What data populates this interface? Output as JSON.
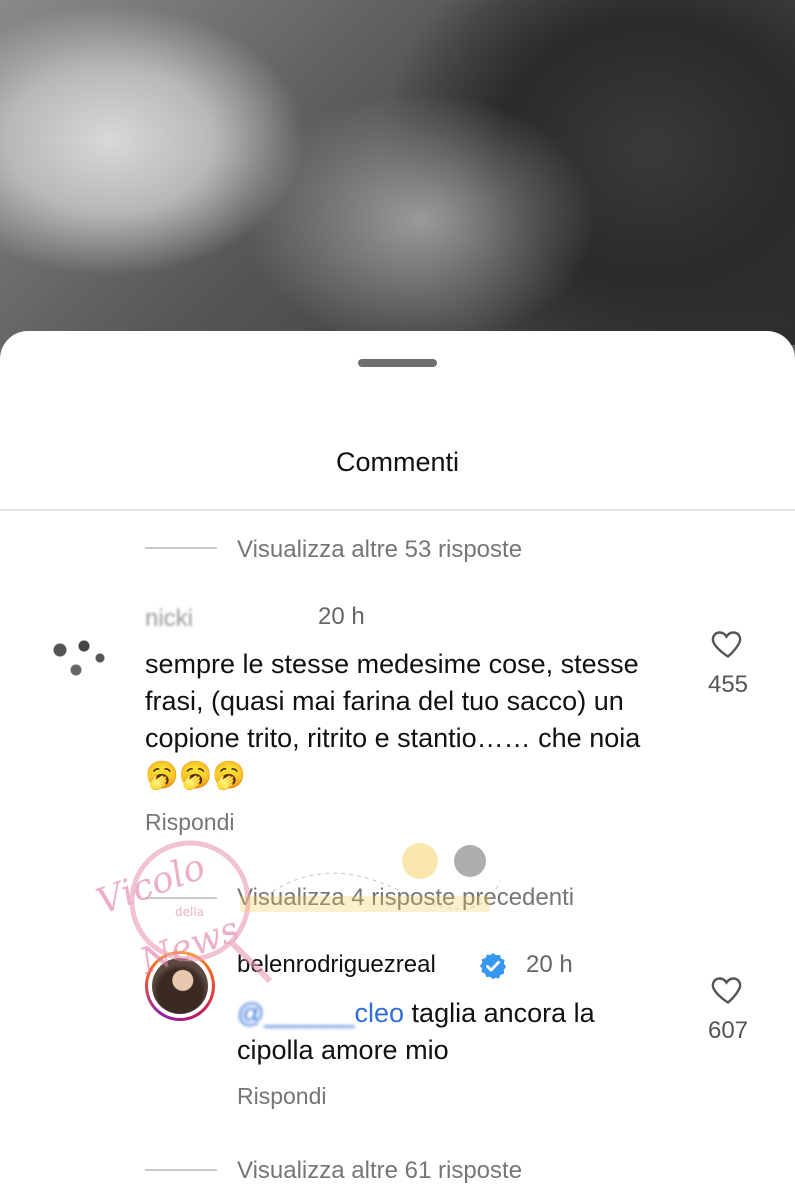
{
  "sheet": {
    "title": "Commenti"
  },
  "thread_top": {
    "view_more": "Visualizza altre 53 risposte"
  },
  "comment1": {
    "username": "nicki",
    "time": "20 h",
    "text": "sempre le stesse medesime cose, stesse frasi, (quasi mai farina del tuo sacco) un copione trito, ritrito e stantio…… che noia",
    "emoji": "🥱🥱🥱",
    "likes": "455",
    "reply_label": "Rispondi"
  },
  "thread_mid": {
    "view_previous": "Visualizza 4 risposte precedenti"
  },
  "comment2": {
    "username": "belenrodriguezreal",
    "time": "20 h",
    "mention_hidden": "@______",
    "mention_visible": "cleo",
    "text": " taglia ancora la cipolla amore mio",
    "likes": "607",
    "reply_label": "Rispondi"
  },
  "thread_bottom": {
    "view_more": "Visualizza altre 61 risposte"
  },
  "watermark": {
    "line1": "Vicolo",
    "line2": "della",
    "line3": "News"
  },
  "colors": {
    "verified": "#3897f0",
    "link": "#2e6fd8",
    "muted": "#767676"
  }
}
